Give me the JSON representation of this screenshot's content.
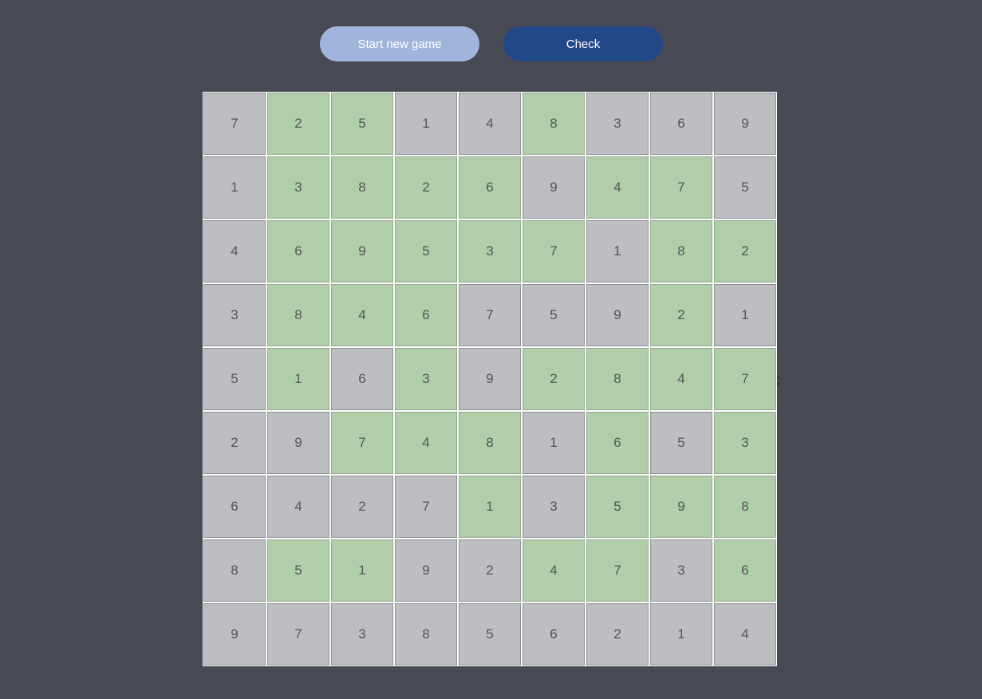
{
  "toolbar": {
    "new_game_label": "Start new game",
    "check_label": "Check"
  },
  "colors": {
    "background": "#474a53",
    "cell_default": "#bdbec1",
    "cell_highlight": "#b0ceaa",
    "new_game_button": "#a1b4dc",
    "check_button": "#23488a"
  },
  "stray_glyph": ";",
  "board": {
    "rows": [
      [
        {
          "v": "7",
          "g": false
        },
        {
          "v": "2",
          "g": true
        },
        {
          "v": "5",
          "g": true
        },
        {
          "v": "1",
          "g": false
        },
        {
          "v": "4",
          "g": false
        },
        {
          "v": "8",
          "g": true
        },
        {
          "v": "3",
          "g": false
        },
        {
          "v": "6",
          "g": false
        },
        {
          "v": "9",
          "g": false
        }
      ],
      [
        {
          "v": "1",
          "g": false
        },
        {
          "v": "3",
          "g": true
        },
        {
          "v": "8",
          "g": true
        },
        {
          "v": "2",
          "g": true
        },
        {
          "v": "6",
          "g": true
        },
        {
          "v": "9",
          "g": false
        },
        {
          "v": "4",
          "g": true
        },
        {
          "v": "7",
          "g": true
        },
        {
          "v": "5",
          "g": false
        }
      ],
      [
        {
          "v": "4",
          "g": false
        },
        {
          "v": "6",
          "g": true
        },
        {
          "v": "9",
          "g": true
        },
        {
          "v": "5",
          "g": true
        },
        {
          "v": "3",
          "g": true
        },
        {
          "v": "7",
          "g": true
        },
        {
          "v": "1",
          "g": false
        },
        {
          "v": "8",
          "g": true
        },
        {
          "v": "2",
          "g": true
        }
      ],
      [
        {
          "v": "3",
          "g": false
        },
        {
          "v": "8",
          "g": true
        },
        {
          "v": "4",
          "g": true
        },
        {
          "v": "6",
          "g": true
        },
        {
          "v": "7",
          "g": false
        },
        {
          "v": "5",
          "g": false
        },
        {
          "v": "9",
          "g": false
        },
        {
          "v": "2",
          "g": true
        },
        {
          "v": "1",
          "g": false
        }
      ],
      [
        {
          "v": "5",
          "g": false
        },
        {
          "v": "1",
          "g": true
        },
        {
          "v": "6",
          "g": false
        },
        {
          "v": "3",
          "g": true
        },
        {
          "v": "9",
          "g": false
        },
        {
          "v": "2",
          "g": true
        },
        {
          "v": "8",
          "g": true
        },
        {
          "v": "4",
          "g": true
        },
        {
          "v": "7",
          "g": true
        }
      ],
      [
        {
          "v": "2",
          "g": false
        },
        {
          "v": "9",
          "g": false
        },
        {
          "v": "7",
          "g": true
        },
        {
          "v": "4",
          "g": true
        },
        {
          "v": "8",
          "g": true
        },
        {
          "v": "1",
          "g": false
        },
        {
          "v": "6",
          "g": true
        },
        {
          "v": "5",
          "g": false
        },
        {
          "v": "3",
          "g": true
        }
      ],
      [
        {
          "v": "6",
          "g": false
        },
        {
          "v": "4",
          "g": false
        },
        {
          "v": "2",
          "g": false
        },
        {
          "v": "7",
          "g": false
        },
        {
          "v": "1",
          "g": true
        },
        {
          "v": "3",
          "g": false
        },
        {
          "v": "5",
          "g": true
        },
        {
          "v": "9",
          "g": true
        },
        {
          "v": "8",
          "g": true
        }
      ],
      [
        {
          "v": "8",
          "g": false
        },
        {
          "v": "5",
          "g": true
        },
        {
          "v": "1",
          "g": true
        },
        {
          "v": "9",
          "g": false
        },
        {
          "v": "2",
          "g": false
        },
        {
          "v": "4",
          "g": true
        },
        {
          "v": "7",
          "g": true
        },
        {
          "v": "3",
          "g": false
        },
        {
          "v": "6",
          "g": true
        }
      ],
      [
        {
          "v": "9",
          "g": false
        },
        {
          "v": "7",
          "g": false
        },
        {
          "v": "3",
          "g": false
        },
        {
          "v": "8",
          "g": false
        },
        {
          "v": "5",
          "g": false
        },
        {
          "v": "6",
          "g": false
        },
        {
          "v": "2",
          "g": false
        },
        {
          "v": "1",
          "g": false
        },
        {
          "v": "4",
          "g": false
        }
      ]
    ]
  }
}
